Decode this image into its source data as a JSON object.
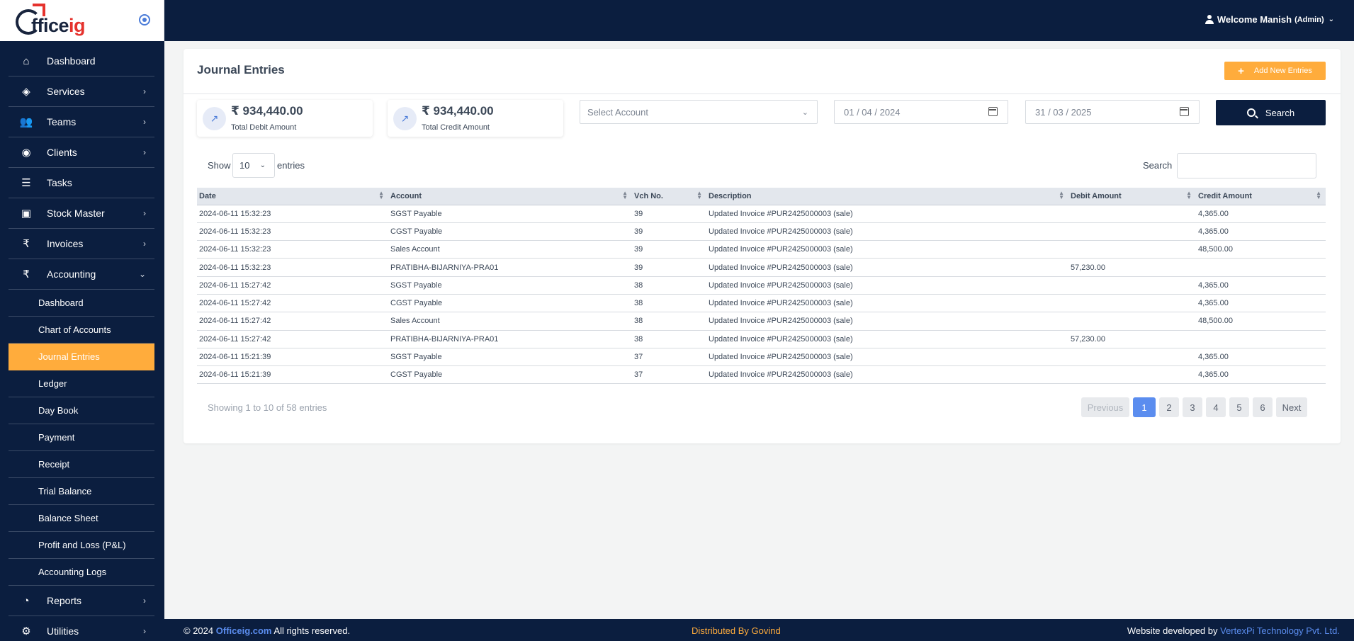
{
  "brand": {
    "logo_main": "ffice",
    "logo_accent": "ig"
  },
  "topbar": {
    "welcome": "Welcome Manish",
    "role": "(Admin)"
  },
  "sidebar": {
    "items": [
      {
        "label": "Dashboard",
        "icon": "home-icon",
        "chevron": false
      },
      {
        "label": "Services",
        "icon": "shield-icon",
        "chevron": true
      },
      {
        "label": "Teams",
        "icon": "users-icon",
        "chevron": true
      },
      {
        "label": "Clients",
        "icon": "user-circle-icon",
        "chevron": true
      },
      {
        "label": "Tasks",
        "icon": "tasks-icon",
        "chevron": false
      },
      {
        "label": "Stock Master",
        "icon": "box-icon",
        "chevron": true
      },
      {
        "label": "Invoices",
        "icon": "rupee-icon",
        "chevron": true
      },
      {
        "label": "Accounting",
        "icon": "rupee-icon",
        "chevron": true,
        "expanded": true
      }
    ],
    "accounting_sub": [
      {
        "label": "Dashboard"
      },
      {
        "label": "Chart of Accounts"
      },
      {
        "label": "Journal Entries",
        "active": true
      },
      {
        "label": "Ledger"
      },
      {
        "label": "Day Book"
      },
      {
        "label": "Payment"
      },
      {
        "label": "Receipt"
      },
      {
        "label": "Trial Balance"
      },
      {
        "label": "Balance Sheet"
      },
      {
        "label": "Profit and Loss (P&L)"
      },
      {
        "label": "Accounting Logs"
      }
    ],
    "bottom_items": [
      {
        "label": "Reports",
        "icon": "pie-chart-icon"
      },
      {
        "label": "Utilities",
        "icon": "gear-icon"
      }
    ]
  },
  "page": {
    "title": "Journal Entries",
    "add_button": "Add New Entries",
    "stats": [
      {
        "value": "₹ 934,440.00",
        "label": "Total Debit Amount"
      },
      {
        "value": "₹ 934,440.00",
        "label": "Total Credit Amount"
      }
    ],
    "filters": {
      "account_placeholder": "Select Account",
      "date_from": "01 / 04 / 2024",
      "date_to": "31 / 03 / 2025",
      "search_button": "Search"
    },
    "length": {
      "show": "Show",
      "value": "10",
      "entries": "entries"
    },
    "search_label": "Search"
  },
  "table": {
    "columns": [
      "Date",
      "Account",
      "Vch No.",
      "Description",
      "Debit Amount",
      "Credit Amount"
    ],
    "rows": [
      {
        "date": "2024-06-11 15:32:23",
        "account": "SGST Payable",
        "orange": true,
        "vch": "39",
        "desc": "Updated Invoice #PUR2425000003 (sale)",
        "debit": "",
        "credit": "4,365.00"
      },
      {
        "date": "2024-06-11 15:32:23",
        "account": "CGST Payable",
        "orange": true,
        "vch": "39",
        "desc": "Updated Invoice #PUR2425000003 (sale)",
        "debit": "",
        "credit": "4,365.00"
      },
      {
        "date": "2024-06-11 15:32:23",
        "account": "Sales Account",
        "orange": true,
        "vch": "39",
        "desc": "Updated Invoice #PUR2425000003 (sale)",
        "debit": "",
        "credit": "48,500.00"
      },
      {
        "date": "2024-06-11 15:32:23",
        "account": "PRATIBHA-BIJARNIYA-PRA01",
        "orange": false,
        "vch": "39",
        "desc": "Updated Invoice #PUR2425000003 (sale)",
        "debit": "57,230.00",
        "credit": ""
      },
      {
        "date": "2024-06-11 15:27:42",
        "account": "SGST Payable",
        "orange": true,
        "vch": "38",
        "desc": "Updated Invoice #PUR2425000003 (sale)",
        "debit": "",
        "credit": "4,365.00"
      },
      {
        "date": "2024-06-11 15:27:42",
        "account": "CGST Payable",
        "orange": true,
        "vch": "38",
        "desc": "Updated Invoice #PUR2425000003 (sale)",
        "debit": "",
        "credit": "4,365.00"
      },
      {
        "date": "2024-06-11 15:27:42",
        "account": "Sales Account",
        "orange": true,
        "vch": "38",
        "desc": "Updated Invoice #PUR2425000003 (sale)",
        "debit": "",
        "credit": "48,500.00"
      },
      {
        "date": "2024-06-11 15:27:42",
        "account": "PRATIBHA-BIJARNIYA-PRA01",
        "orange": false,
        "vch": "38",
        "desc": "Updated Invoice #PUR2425000003 (sale)",
        "debit": "57,230.00",
        "credit": ""
      },
      {
        "date": "2024-06-11 15:21:39",
        "account": "SGST Payable",
        "orange": true,
        "vch": "37",
        "desc": "Updated Invoice #PUR2425000003 (sale)",
        "debit": "",
        "credit": "4,365.00"
      },
      {
        "date": "2024-06-11 15:21:39",
        "account": "CGST Payable",
        "orange": true,
        "vch": "37",
        "desc": "Updated Invoice #PUR2425000003 (sale)",
        "debit": "",
        "credit": "4,365.00"
      }
    ]
  },
  "pagination": {
    "info": "Showing 1 to 10 of 58 entries",
    "previous": "Previous",
    "next": "Next",
    "pages": [
      "1",
      "2",
      "3",
      "4",
      "5",
      "6"
    ],
    "current": "1"
  },
  "footer": {
    "copyright_prefix": "© 2024",
    "site": "Officeig.com",
    "rights": "All rights reserved.",
    "distributed": "Distributed By Govind",
    "developed_prefix": "Website developed by",
    "developer": "VertexPi Technology Pvt. Ltd."
  },
  "colors": {
    "navy": "#0b1e3f",
    "accent": "#ffac3c",
    "link": "#5b8def"
  }
}
